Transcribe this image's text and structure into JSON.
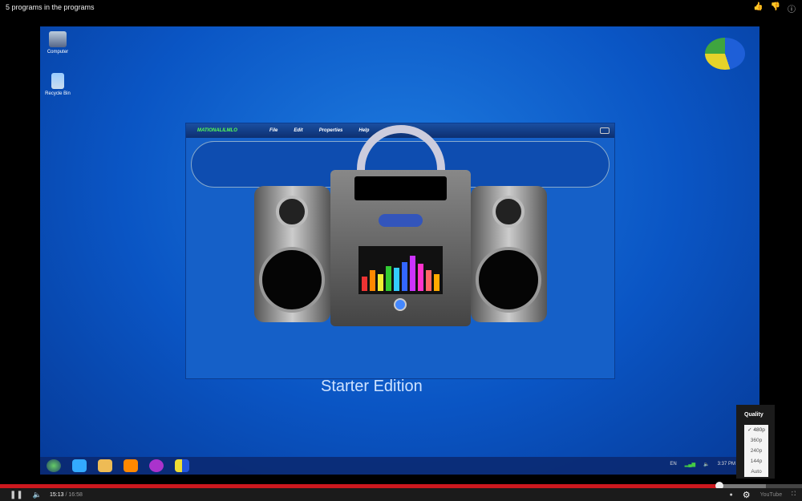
{
  "header": {
    "title": "5 programs in the programs",
    "icons": [
      "thumbs-up-icon",
      "thumbs-down-icon",
      "info-icon"
    ]
  },
  "desktop": {
    "icons": [
      {
        "label": "Computer",
        "icon": "computer-icon"
      },
      {
        "label": "Recycle Bin",
        "icon": "recycle-bin-icon"
      }
    ],
    "watermark": "Starter Edition",
    "taskbar": {
      "items": [
        "start-orb-icon",
        "internet-explorer-icon",
        "explorer-folder-icon",
        "media-player-icon",
        "media-center-icon",
        "app-icon"
      ],
      "lang": "EN",
      "clock": "3:37 PM"
    }
  },
  "app": {
    "brand": "MATIONALILMLO",
    "menu": [
      "File",
      "Edit",
      "Properties",
      "Help"
    ],
    "eq_colors": [
      "#e33",
      "#f80",
      "#ee3",
      "#3c3",
      "#3cf",
      "#36f",
      "#c3f",
      "#f3c",
      "#f66",
      "#fa0"
    ],
    "eq_levels": [
      0.35,
      0.5,
      0.4,
      0.6,
      0.55,
      0.7,
      0.85,
      0.65,
      0.5,
      0.4
    ]
  },
  "quality_menu": {
    "title": "Quality",
    "options": [
      "480p",
      "360p",
      "240p",
      "144p",
      "Auto"
    ],
    "selected": "480p"
  },
  "player": {
    "current_time": "15:13",
    "duration": "16:58",
    "time_sep": "/",
    "progress": 0.897,
    "buffered": 0.955,
    "brand": "YouTube",
    "accent": "#cc181e"
  }
}
